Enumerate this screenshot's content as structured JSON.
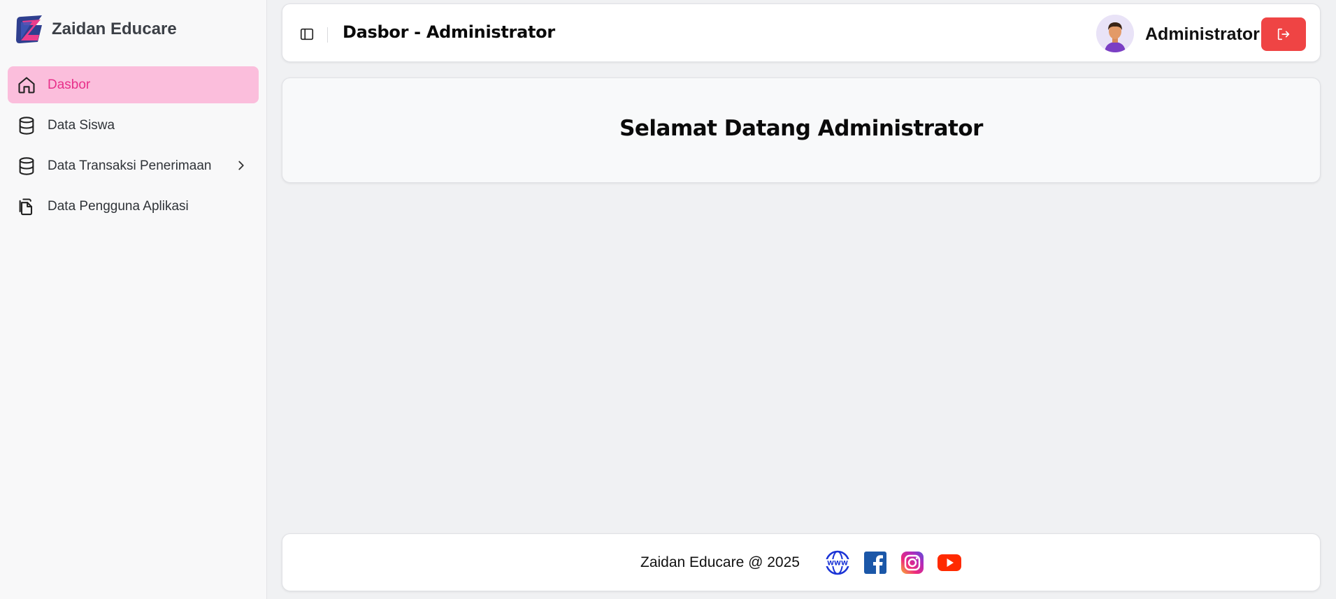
{
  "brand": {
    "name": "Zaidan Educare"
  },
  "sidebar": {
    "items": [
      {
        "label": "Dasbor",
        "icon": "home-icon",
        "active": true
      },
      {
        "label": "Data Siswa",
        "icon": "database-icon"
      },
      {
        "label": "Data Transaksi Penerimaan",
        "icon": "database-icon",
        "has_submenu": true
      },
      {
        "label": "Data Pengguna Aplikasi",
        "icon": "copy-document-icon"
      }
    ]
  },
  "header": {
    "title": "Dasbor - Administrator",
    "user_name": "Administrator",
    "toggle_icon": "sidebar-toggle-icon",
    "logout_icon": "logout-icon"
  },
  "main": {
    "welcome": "Selamat Datang Administrator"
  },
  "footer": {
    "text": "Zaidan Educare @ 2025",
    "social": [
      "www-globe-icon",
      "facebook-icon",
      "instagram-icon",
      "youtube-icon"
    ]
  },
  "colors": {
    "accent": "#e8308a",
    "active_bg": "#fbbedc",
    "logout": "#ef4444",
    "sidebar_bg": "#f8f8f9",
    "page_bg": "#f0f1f3"
  }
}
